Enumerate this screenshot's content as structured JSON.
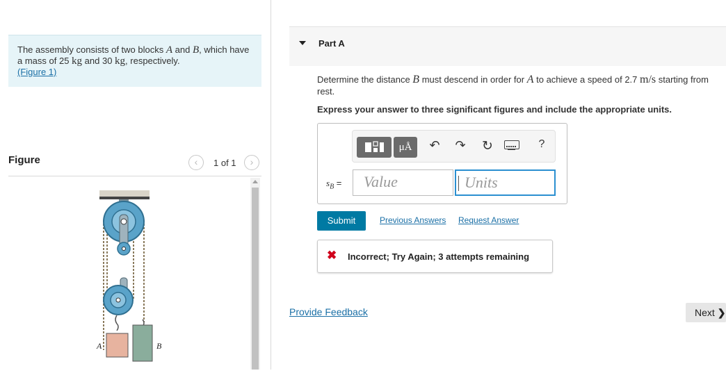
{
  "problem": {
    "text_1": "The assembly consists of two blocks ",
    "sym_a": "A",
    "text_2": " and ",
    "sym_b": "B",
    "text_3": ", which have a mass of 25 ",
    "unit_1": "kg",
    "text_4": " and 30 ",
    "unit_2": "kg",
    "text_5": ", respectively.",
    "figure_link": "(Figure 1)"
  },
  "figure": {
    "title": "Figure",
    "counter": "1 of 1",
    "prev_icon": "‹",
    "next_icon": "›",
    "label_a": "A",
    "label_b": "B"
  },
  "part": {
    "title": "Part A"
  },
  "question": {
    "text_1": "Determine the distance ",
    "sym_b": "B",
    "text_2": " must descend in order for ",
    "sym_a": "A",
    "text_3": " to achieve a speed of 2.7 ",
    "unit": "m/s",
    "text_4": " starting from rest.",
    "instruction": "Express your answer to three significant figures and include the appropriate units."
  },
  "answer": {
    "var_main": "s",
    "var_sub": "B",
    "equals": " =",
    "value_placeholder": "Value",
    "units_placeholder": "Units",
    "units_button_label": "μÅ",
    "undo_icon": "↶",
    "redo_icon": "↷",
    "reset_icon": "↻",
    "help_icon": "?"
  },
  "actions": {
    "submit": "Submit",
    "previous_answers": "Previous Answers",
    "request_answer": "Request Answer"
  },
  "feedback": {
    "icon": "✖",
    "message": "Incorrect; Try Again; 3 attempts remaining"
  },
  "footer": {
    "provide_feedback": "Provide Feedback",
    "next": "Next",
    "next_icon": "❯"
  },
  "colors": {
    "accent": "#007aa3",
    "error": "#d0021b",
    "problem_bg": "#e6f4f8",
    "block_a": "#e7b39f",
    "block_b": "#8aad9c",
    "pulley": "#5aa3c9"
  }
}
